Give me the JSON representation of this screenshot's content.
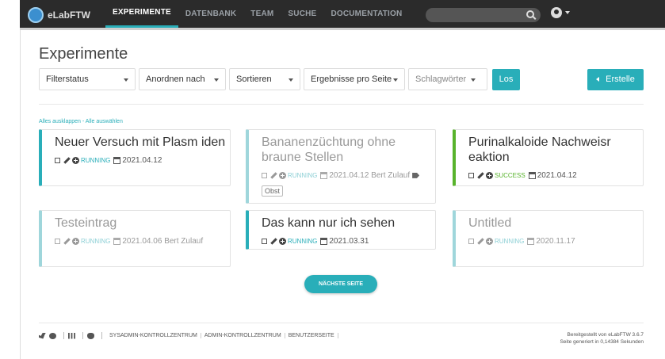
{
  "navbar": {
    "brand": "eLabFTW",
    "items": [
      "EXPERIMENTE",
      "DATENBANK",
      "TEAM",
      "SUCHE",
      "DOCUMENTATION"
    ],
    "active": "EXPERIMENTE"
  },
  "page_title": "Experimente",
  "filters": {
    "status": "Filterstatus",
    "order": "Anordnen nach",
    "sort": "Sortieren",
    "per_page": "Ergebnisse pro Seite",
    "tags": "Schlagwörter",
    "go": "Los",
    "create": "Erstelle"
  },
  "links": "Alles ausklappen - Alle auswählen",
  "cards": [
    {
      "title": "Neuer Versuch mit Plasm iden",
      "status": "RUNNING",
      "date": "2021.04.12",
      "author": ""
    },
    {
      "title": "Bananenzüchtung ohne braune Stellen",
      "status": "RUNNING",
      "date": "2021.04.12",
      "author": "Bert Zulauf",
      "tag": "Obst"
    },
    {
      "title": "Purinalkaloide Nachweisr eaktion",
      "status": "SUCCESS",
      "date": "2021.04.12",
      "author": ""
    },
    {
      "title": "Testeintrag",
      "status": "RUNNING",
      "date": "2021.04.06",
      "author": "Bert Zulauf"
    },
    {
      "title": "Das kann nur ich sehen",
      "status": "RUNNING",
      "date": "2021.03.31",
      "author": ""
    },
    {
      "title": "Untitled",
      "status": "RUNNING",
      "date": "2020.11.17",
      "author": ""
    }
  ],
  "next_page": "NÄCHSTE SEITE",
  "footer": {
    "links": [
      "SYSADMIN-KONTROLLZENTRUM",
      "ADMIN-KONTROLLZENTRUM",
      "BENUTZERSEITE"
    ],
    "powered": "Bereitgestellt von eLabFTW 3.6.7",
    "generated": "Seite generiert in 0,14384 Sekunden"
  },
  "colors": {
    "accent": "#29aeb9",
    "success": "#58b32c",
    "navbar": "#2b2b2b"
  }
}
